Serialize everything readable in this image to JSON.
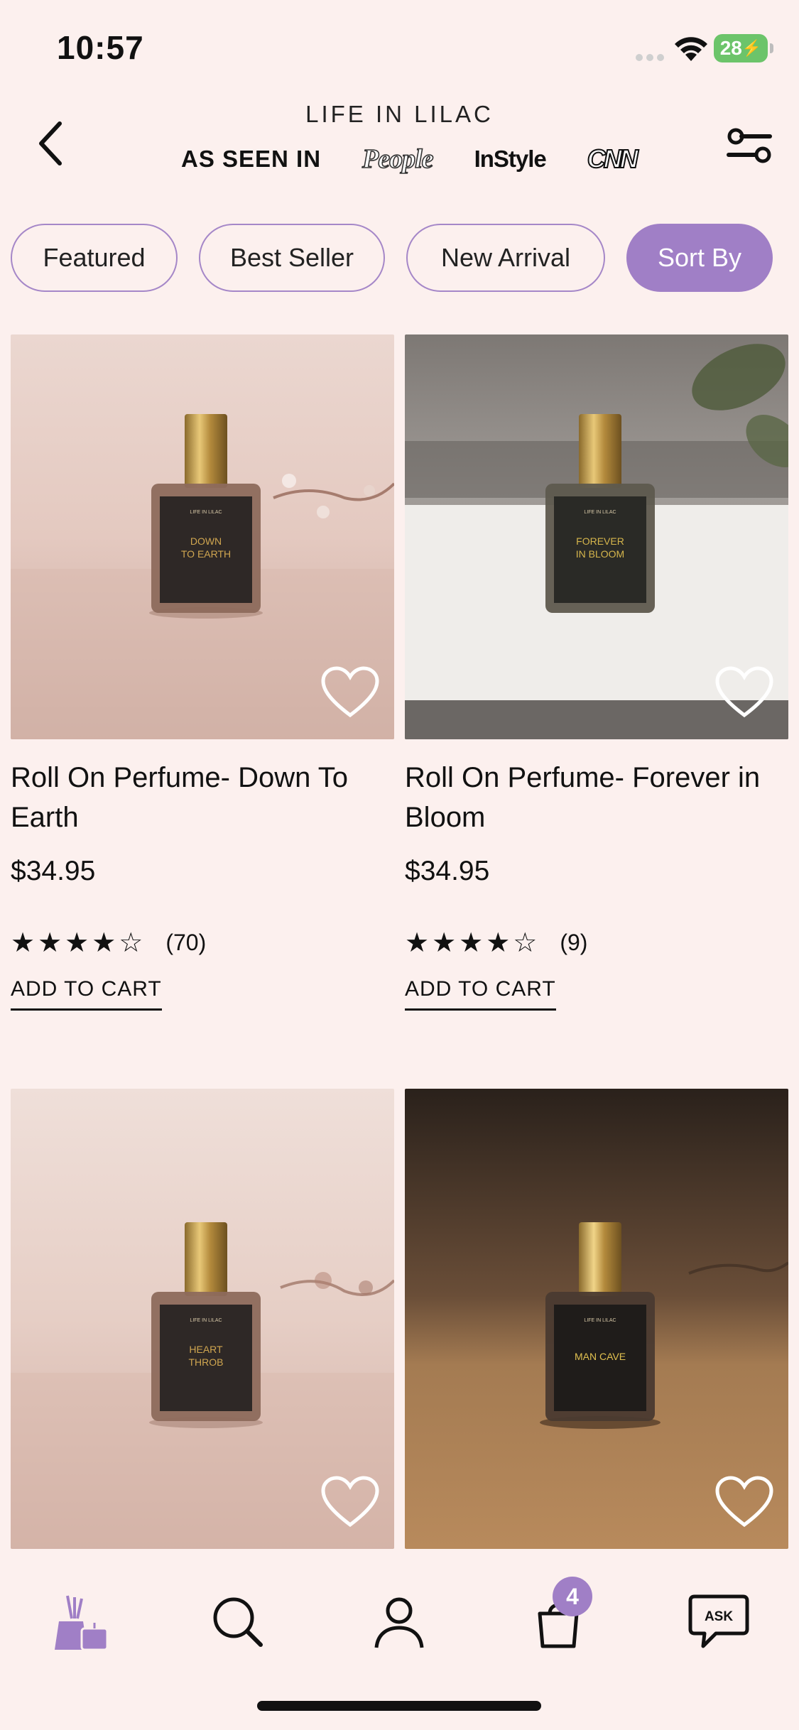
{
  "status": {
    "time": "10:57",
    "battery": "28"
  },
  "header": {
    "brand": "LIFE IN LILAC",
    "as_seen_in": "AS SEEN IN",
    "press": [
      "People",
      "InStyle",
      "CNN"
    ]
  },
  "chips": [
    {
      "label": "Featured",
      "active": false
    },
    {
      "label": "Best Seller",
      "active": false
    },
    {
      "label": "New Arrival",
      "active": false
    },
    {
      "label": "Sort By",
      "active": true
    }
  ],
  "products": [
    {
      "title": "Roll On Perfume- Down To Earth",
      "price": "$34.95",
      "rating": 4,
      "stars": "★★★★☆",
      "reviews": "(70)",
      "cta": "ADD TO CART",
      "label_name": "DOWN TO EARTH",
      "label_brand": "LIFE IN LILAC"
    },
    {
      "title": "Roll On Perfume- Forever in Bloom",
      "price": "$34.95",
      "rating": 4,
      "stars": "★★★★☆",
      "reviews": "(9)",
      "cta": "ADD TO CART",
      "label_name": "FOREVER IN BLOOM",
      "label_brand": "LIFE IN LILAC"
    },
    {
      "label_name": "HEART THROB",
      "label_brand": "LIFE IN LILAC"
    },
    {
      "label_name": "MAN CAVE",
      "label_brand": "LIFE IN LILAC"
    }
  ],
  "tabbar": {
    "cart_badge": "4",
    "ask_label": "ASK"
  },
  "colors": {
    "accent": "#a07fc6",
    "background": "#fcf0ee",
    "battery": "#6cc46a"
  }
}
